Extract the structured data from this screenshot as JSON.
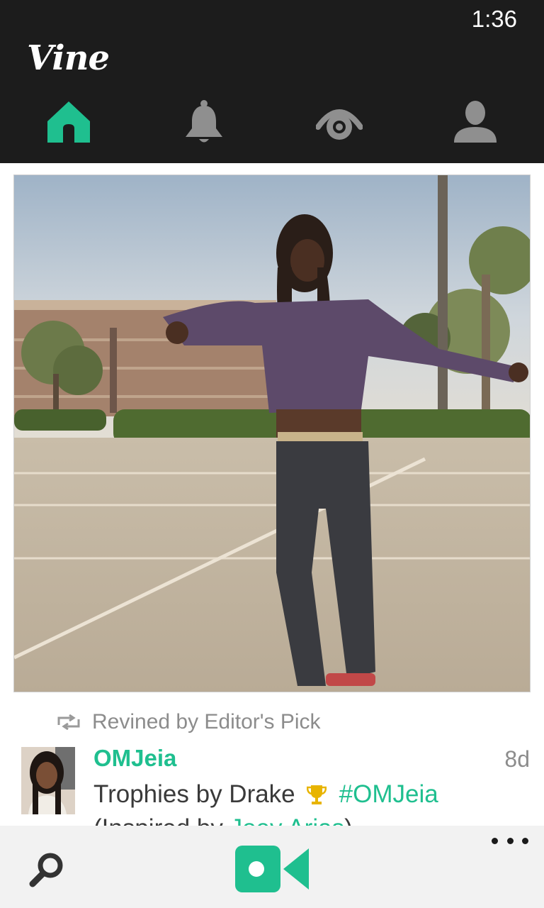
{
  "status_bar": {
    "time": "1:36"
  },
  "header": {
    "logo": "Vine",
    "tabs": [
      {
        "name": "home",
        "icon": "home-icon",
        "active": true
      },
      {
        "name": "activity",
        "icon": "bell-icon",
        "active": false
      },
      {
        "name": "explore",
        "icon": "eye-icon",
        "active": false
      },
      {
        "name": "profile",
        "icon": "person-icon",
        "active": false
      }
    ]
  },
  "post": {
    "revine_label": "Revined by Editor's Pick",
    "author": "OMJeia",
    "age": "8d",
    "description": "Trophies by Drake",
    "hashtag": "#OMJeia",
    "inspired_prefix": "(Inspired by ",
    "inspired_name": "Joey Arias",
    "inspired_suffix": ")"
  },
  "bottom_bar": {
    "search_icon": "search-icon",
    "record_icon": "video-camera-icon",
    "more_icon": "more-icon"
  },
  "colors": {
    "accent": "#1fbf8f",
    "header_bg": "#1c1c1c",
    "inactive_icon": "#8f8f8f",
    "trophy": "#e8b400",
    "bottom_bar_bg": "#f2f2f2"
  }
}
